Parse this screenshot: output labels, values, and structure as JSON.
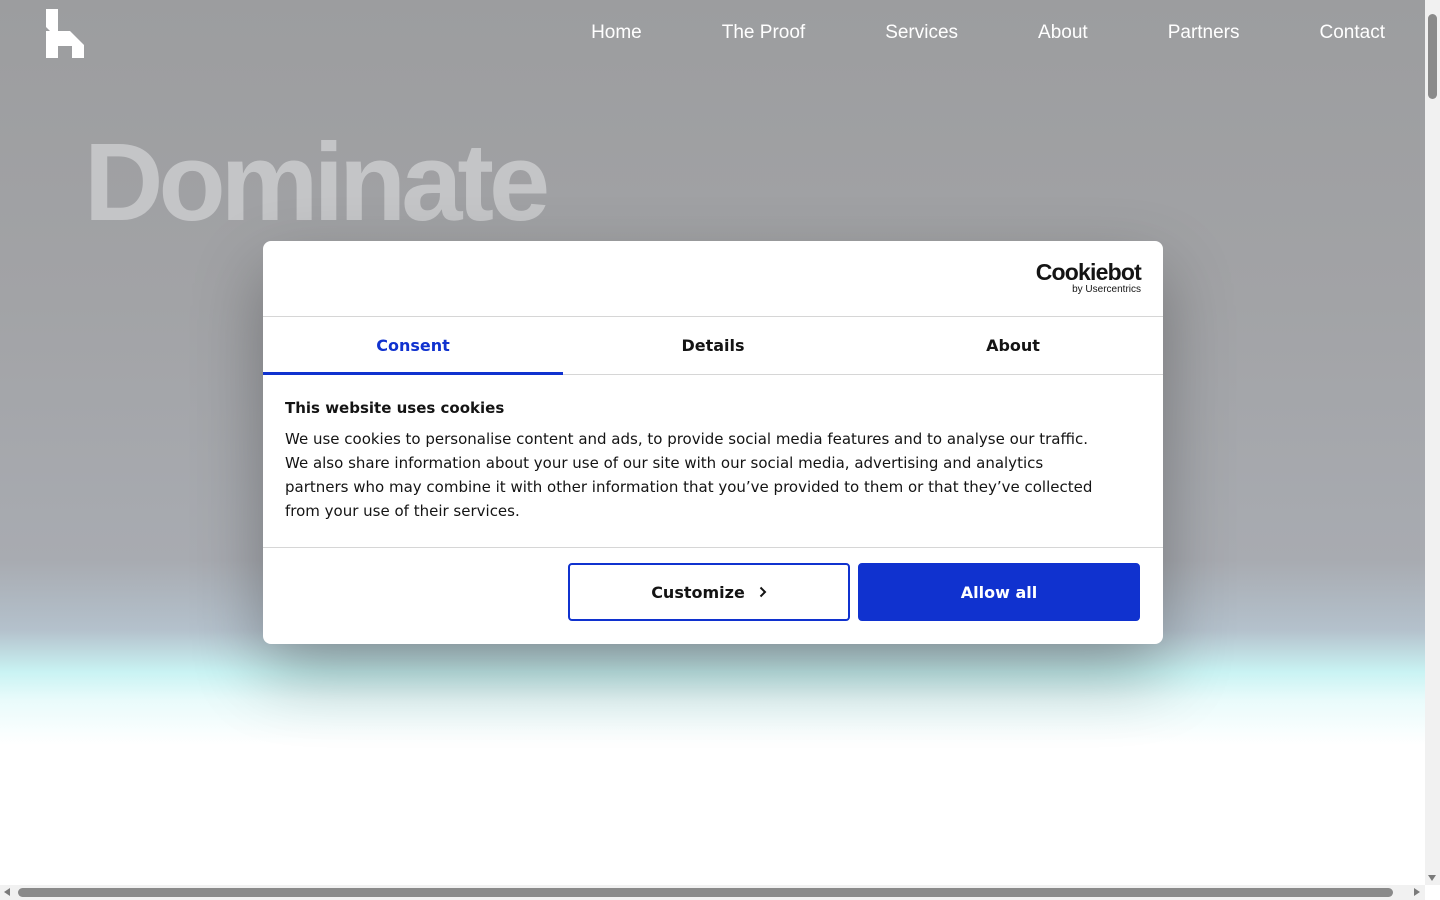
{
  "nav": {
    "logo_icon": "brand-logo-icon",
    "items": [
      {
        "label": "Home"
      },
      {
        "label": "The Proof"
      },
      {
        "label": "Services"
      },
      {
        "label": "About"
      },
      {
        "label": "Partners"
      },
      {
        "label": "Contact"
      }
    ]
  },
  "hero": {
    "headline": "Dominate"
  },
  "cookie_dialog": {
    "brand": "Cookiebot",
    "brand_sub": "by Usercentrics",
    "tabs": [
      {
        "label": "Consent",
        "active": true
      },
      {
        "label": "Details",
        "active": false
      },
      {
        "label": "About",
        "active": false
      }
    ],
    "heading": "This website uses cookies",
    "text": "We use cookies to personalise content and ads, to provide social media features and to analyse our traffic. We also share information about your use of our site with our social media, advertising and analytics partners who may combine it with other information that you’ve provided to them or that they’ve collected from your use of their services.",
    "customize_label": "Customize",
    "customize_icon": "chevron-right-icon",
    "allow_all_label": "Allow all",
    "accent_color": "#1032cf"
  }
}
